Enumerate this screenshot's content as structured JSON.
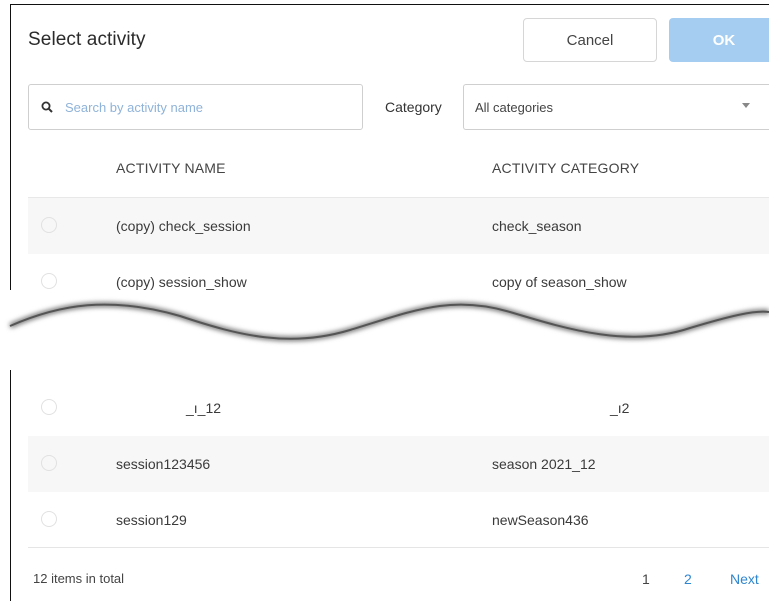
{
  "dialog": {
    "title": "Select activity",
    "cancel_label": "Cancel",
    "ok_label": "OK"
  },
  "search": {
    "placeholder": "Search by activity name",
    "value": ""
  },
  "category": {
    "label": "Category",
    "selected": "All categories"
  },
  "table": {
    "headers": [
      "ACTIVITY NAME",
      "ACTIVITY CATEGORY"
    ],
    "rows": [
      {
        "name": "(copy) check_session",
        "category": "check_season"
      },
      {
        "name": "(copy) session_show",
        "category": "copy of season_show"
      },
      {
        "name": "_ı_12",
        "category": "_ı2"
      },
      {
        "name": "session123456",
        "category": "season 2021_12"
      },
      {
        "name": "session129",
        "category": "newSeason436"
      }
    ]
  },
  "footer": {
    "total": "12 items in total",
    "pages": [
      "1",
      "2"
    ],
    "next_label": "Next"
  },
  "colors": {
    "ok_bg": "#a4cdf1",
    "link": "#2e86d1",
    "row_alt": "#f7f7f7"
  }
}
